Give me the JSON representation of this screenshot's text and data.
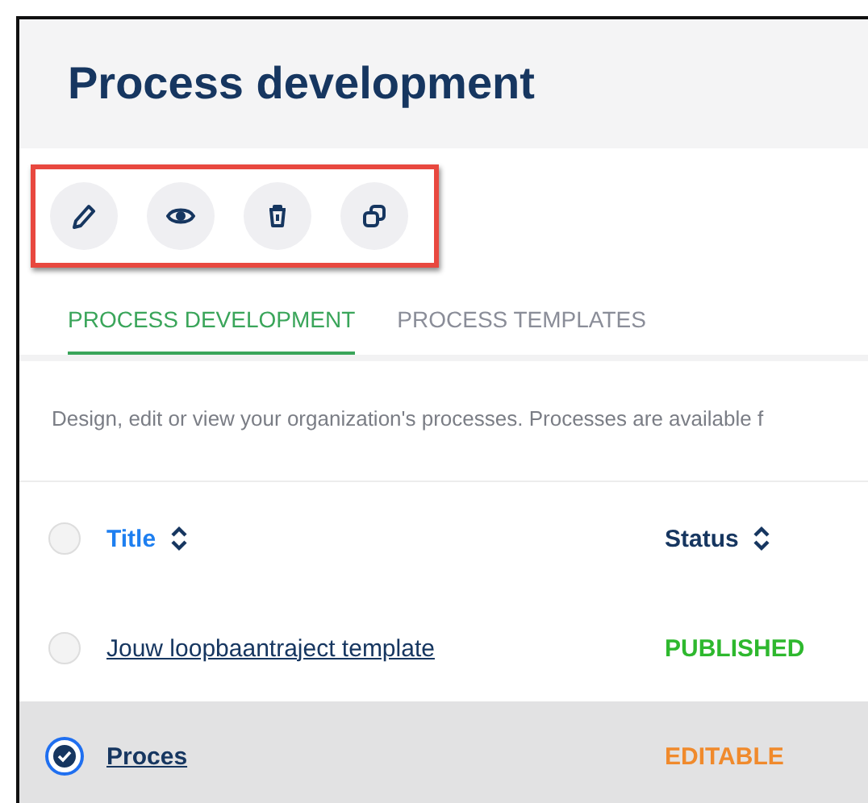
{
  "page": {
    "title": "Process development"
  },
  "toolbar": {
    "highlighted": true,
    "actions": [
      {
        "kind": "edit"
      },
      {
        "kind": "view"
      },
      {
        "kind": "delete"
      },
      {
        "kind": "duplicate"
      }
    ]
  },
  "tabs": [
    {
      "label": "PROCESS DEVELOPMENT",
      "selected": true
    },
    {
      "label": "PROCESS TEMPLATES",
      "selected": false
    }
  ],
  "description": "Design, edit or view your organization's processes. Processes are available f",
  "table": {
    "all_selected": false,
    "columns": [
      {
        "label": "Title",
        "sorted": true
      },
      {
        "label": "Status",
        "sorted": false
      }
    ],
    "rows": [
      {
        "title": "Jouw loopbaantraject template",
        "status": "PUBLISHED",
        "color": "#2eb82e",
        "selected": false
      },
      {
        "title": "Proces",
        "status": "EDITABLE",
        "color": "#f08a2c",
        "selected": true
      }
    ]
  }
}
